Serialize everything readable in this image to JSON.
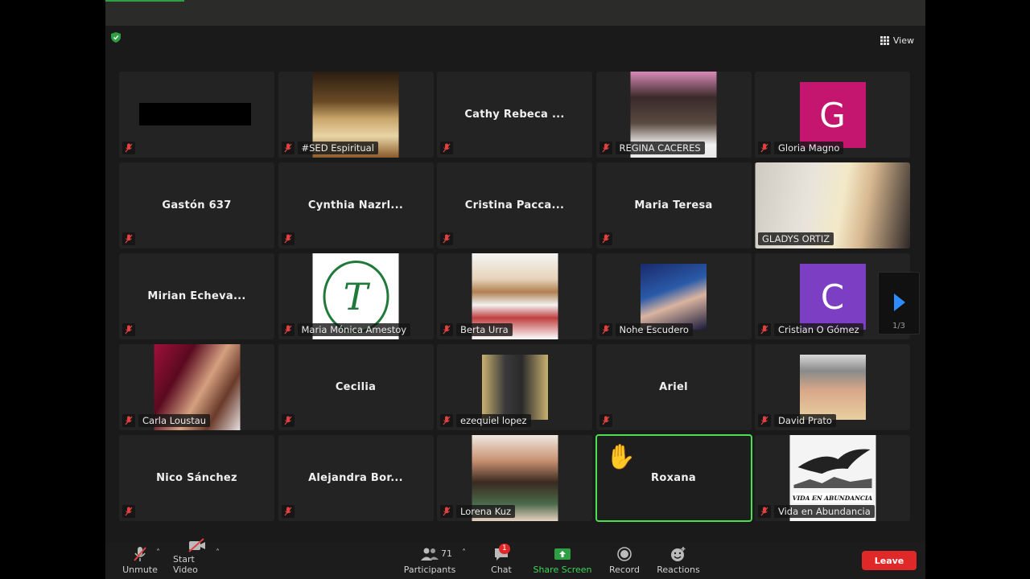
{
  "view_label": "View",
  "pager": {
    "text": "1/3"
  },
  "tiles": [
    {
      "label": ""
    },
    {
      "label": "#SED Espiritual"
    },
    {
      "name": "Cathy Rebeca ..."
    },
    {
      "label": "REGINA CACERES"
    },
    {
      "label": "Gloria Magno",
      "avatar_letter": "G",
      "avatar_color": "#c4166f"
    },
    {
      "name": "Gastón 637"
    },
    {
      "name": "Cynthia Nazrl..."
    },
    {
      "name": "Cristina Pacca..."
    },
    {
      "name": "Maria Teresa"
    },
    {
      "label": "GLADYS ORTIZ"
    },
    {
      "name": "Mirian Echeva..."
    },
    {
      "label": "Maria Mónica Amestoy",
      "logo_letter": "T"
    },
    {
      "label": "Berta Urra"
    },
    {
      "label": "Nohe Escudero"
    },
    {
      "label": "Cristian O Gómez",
      "avatar_letter": "C",
      "avatar_color": "#7c3fc4"
    },
    {
      "label": "Carla Loustau"
    },
    {
      "name": "Cecilia"
    },
    {
      "label": "ezequiel lopez"
    },
    {
      "name": "Ariel"
    },
    {
      "label": "David Prato"
    },
    {
      "name": "Nico Sánchez"
    },
    {
      "name": "Alejandra Bor..."
    },
    {
      "label": "Lorena Kuz"
    },
    {
      "name": "Roxana",
      "hand": "✋"
    },
    {
      "label": "Vida en Abundancia",
      "logo_text": "VIDA EN ABUNDANCIA"
    }
  ],
  "toolbar": {
    "unmute": "Unmute",
    "start_video": "Start Video",
    "participants": "Participants",
    "participants_count": "71",
    "chat": "Chat",
    "chat_badge": "1",
    "share_screen": "Share Screen",
    "record": "Record",
    "reactions": "Reactions",
    "leave": "Leave"
  },
  "colors": {
    "accent_green": "#3ed35b",
    "leave_red": "#e02828",
    "mute_red": "#e04040",
    "pager_blue": "#2d8cff"
  }
}
